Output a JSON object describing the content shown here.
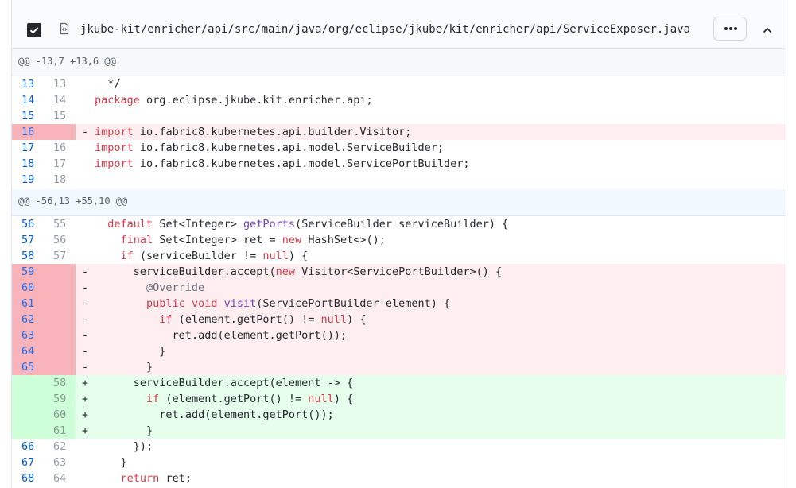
{
  "file": {
    "path": "jkube-kit/enricher/api/src/main/java/org/eclipse/jkube/kit/enricher/api/ServiceExposer.java",
    "menu_icon": "kebab-horizontal-icon",
    "collapse_icon": "chevron-up-icon",
    "viewed_checkbox_checked": true
  },
  "hunks": [
    {
      "header": "@@ -13,7 +13,6 @@",
      "lines": [
        {
          "type": "ctx",
          "old": "13",
          "new": "13",
          "marker": " ",
          "code": "  */"
        },
        {
          "type": "ctx",
          "old": "14",
          "new": "14",
          "marker": " ",
          "code": "package org.eclipse.jkube.kit.enricher.api;"
        },
        {
          "type": "ctx",
          "old": "15",
          "new": "15",
          "marker": " ",
          "code": ""
        },
        {
          "type": "del",
          "old": "16",
          "new": "",
          "marker": "-",
          "code": "import io.fabric8.kubernetes.api.builder.Visitor;"
        },
        {
          "type": "ctx",
          "old": "17",
          "new": "16",
          "marker": " ",
          "code": "import io.fabric8.kubernetes.api.model.ServiceBuilder;"
        },
        {
          "type": "ctx",
          "old": "18",
          "new": "17",
          "marker": " ",
          "code": "import io.fabric8.kubernetes.api.model.ServicePortBuilder;"
        },
        {
          "type": "ctx",
          "old": "19",
          "new": "18",
          "marker": " ",
          "code": ""
        }
      ]
    },
    {
      "header": "@@ -56,13 +55,10 @@",
      "lines": [
        {
          "type": "ctx",
          "old": "56",
          "new": "55",
          "marker": " ",
          "code": "  default Set<Integer> getPorts(ServiceBuilder serviceBuilder) {"
        },
        {
          "type": "ctx",
          "old": "57",
          "new": "56",
          "marker": " ",
          "code": "    final Set<Integer> ret = new HashSet<>();"
        },
        {
          "type": "ctx",
          "old": "58",
          "new": "57",
          "marker": " ",
          "code": "    if (serviceBuilder != null) {"
        },
        {
          "type": "del",
          "old": "59",
          "new": "",
          "marker": "-",
          "code": "      serviceBuilder.accept(new Visitor<ServicePortBuilder>() {"
        },
        {
          "type": "del",
          "old": "60",
          "new": "",
          "marker": "-",
          "code": "        @Override"
        },
        {
          "type": "del",
          "old": "61",
          "new": "",
          "marker": "-",
          "code": "        public void visit(ServicePortBuilder element) {"
        },
        {
          "type": "del",
          "old": "62",
          "new": "",
          "marker": "-",
          "code": "          if (element.getPort() != null) {"
        },
        {
          "type": "del",
          "old": "63",
          "new": "",
          "marker": "-",
          "code": "            ret.add(element.getPort());"
        },
        {
          "type": "del",
          "old": "64",
          "new": "",
          "marker": "-",
          "code": "          }"
        },
        {
          "type": "del",
          "old": "65",
          "new": "",
          "marker": "-",
          "code": "        }"
        },
        {
          "type": "add",
          "old": "",
          "new": "58",
          "marker": "+",
          "code": "      serviceBuilder.accept(element -> {"
        },
        {
          "type": "add",
          "old": "",
          "new": "59",
          "marker": "+",
          "code": "        if (element.getPort() != null) {"
        },
        {
          "type": "add",
          "old": "",
          "new": "60",
          "marker": "+",
          "code": "          ret.add(element.getPort());"
        },
        {
          "type": "add",
          "old": "",
          "new": "61",
          "marker": "+",
          "code": "        }"
        },
        {
          "type": "ctx",
          "old": "66",
          "new": "62",
          "marker": " ",
          "code": "      });"
        },
        {
          "type": "ctx",
          "old": "67",
          "new": "63",
          "marker": " ",
          "code": "    }"
        },
        {
          "type": "ctx",
          "old": "68",
          "new": "64",
          "marker": " ",
          "code": "    return ret;"
        }
      ]
    }
  ],
  "keywords": [
    "package",
    "import",
    "default",
    "final",
    "new",
    "if",
    "null",
    "public",
    "void",
    "return"
  ],
  "functions": [
    "getPorts",
    "visit"
  ],
  "colors": {
    "keyword": "#d73a49",
    "function": "#6f42c1",
    "annotation": "#6a737d",
    "deleted_bg": "#ffeef0",
    "added_bg": "#e6ffed"
  }
}
